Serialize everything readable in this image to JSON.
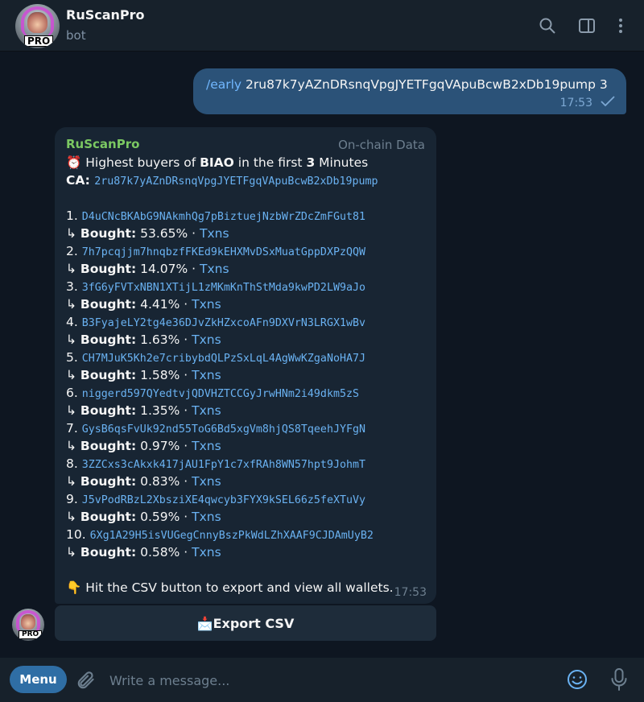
{
  "header": {
    "title": "RuScanPro",
    "subtitle": "bot",
    "avatar_badge": "PRO"
  },
  "outgoing": {
    "command": "/early",
    "args": " 2ru87k7yAZnDRsnqVpgJYETFgqVApuBcwB2xDb19pump 3",
    "time": "17:53"
  },
  "incoming": {
    "sender": "RuScanPro",
    "badge": "On-chain Data",
    "heading_emoji": "⏰",
    "heading_pre": " Highest buyers of ",
    "token": "BIAO",
    "heading_mid": " in the first ",
    "minutes": "3",
    "heading_post": " Minutes",
    "ca_label": " CA: ",
    "ca_value": "2ru87k7yAZnDRsnqVpgJYETFgqVApuBcwB2xDb19pump",
    "bought_arrow": "↳ ",
    "bought_label": "Bought:",
    "separator": " · ",
    "txns_label": "Txns",
    "buyers": [
      {
        "num": "1.",
        "wallet": "D4uCNcBKAbG9NAkmhQg7pBiztuejNzbWrZDcZmFGut81",
        "pct": "53.65%"
      },
      {
        "num": "2.",
        "wallet": "7h7pcqjjm7hnqbzfFKEd9kEHXMvDSxMuatGppDXPzQQW",
        "pct": "14.07%"
      },
      {
        "num": "3.",
        "wallet": "3fG6yFVTxNBN1XTijL1zMKmKnThStMda9kwPD2LW9aJo",
        "pct": "4.41%"
      },
      {
        "num": "4.",
        "wallet": "B3FyajeLY2tg4e36DJvZkHZxcoAFn9DXVrN3LRGX1wBv",
        "pct": "1.63%"
      },
      {
        "num": "5.",
        "wallet": "CH7MJuK5Kh2e7cribybdQLPzSxLqL4AgWwKZgaNoHA7J",
        "pct": "1.58%"
      },
      {
        "num": "6.",
        "wallet": "niggerd597QYedtvjQDVHZTCCGyJrwHNm2i49dkm5zS",
        "pct": "1.35%"
      },
      {
        "num": "7.",
        "wallet": "GysB6qsFvUk92nd55ToG6Bd5xgVm8hjQS8TqeehJYFgN",
        "pct": "0.97%"
      },
      {
        "num": "8.",
        "wallet": "3ZZCxs3cAkxk417jAU1FpY1c7xfRAh8WN57hpt9JohmT",
        "pct": "0.83%"
      },
      {
        "num": "9.",
        "wallet": "J5vPodRBzL2XbsziXE4qwcyb3FYX9kSEL66z5feXTuVy",
        "pct": "0.59%"
      },
      {
        "num": "10.",
        "wallet": "6Xg1A29H5isVUGegCnnyBszPkWdLZhXAAF9CJDAmUyB2",
        "pct": "0.58%"
      }
    ],
    "footer_emoji": "👇",
    "footer": " Hit the CSV button to export and view all wallets.",
    "time": "17:53"
  },
  "keyboard": {
    "button_emoji": "📩",
    "button_label": " Export CSV"
  },
  "composer": {
    "menu_label": "Menu",
    "placeholder": "Write a message..."
  },
  "colors": {
    "background": "#0e1621",
    "header": "#17212b",
    "outgoing_bubble": "#2b5278",
    "incoming_bubble": "#182533",
    "link": "#6ab2f2",
    "sender": "#7bc862",
    "menu_button": "#2f6ea5"
  },
  "icons": [
    "search-icon",
    "sidebar-toggle-icon",
    "more-vertical-icon",
    "double-check-icon",
    "paperclip-icon",
    "emoji-icon",
    "microphone-icon"
  ]
}
